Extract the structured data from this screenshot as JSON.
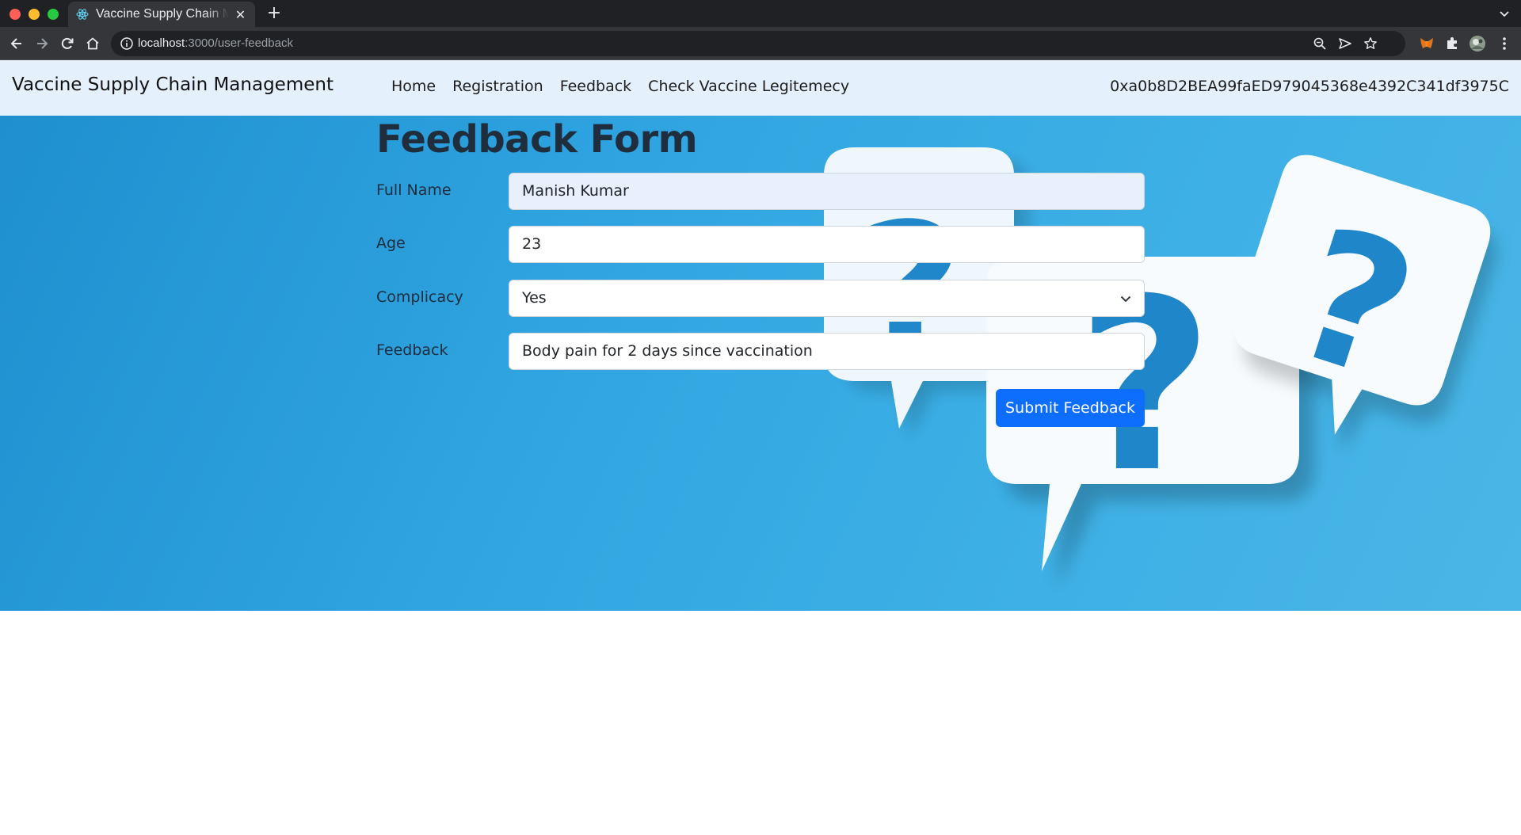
{
  "browser": {
    "tab_title": "Vaccine Supply Chain Management",
    "url_host": "localhost",
    "url_path": ":3000/user-feedback"
  },
  "navbar": {
    "brand": "Vaccine Supply Chain Management",
    "links": [
      "Home",
      "Registration",
      "Feedback",
      "Check Vaccine Legitemecy"
    ],
    "account": "0xa0b8D2BEA99faED979045368e4392C341df3975C"
  },
  "form": {
    "title": "Feedback Form",
    "full_name": {
      "label": "Full Name",
      "value": "Manish Kumar"
    },
    "age": {
      "label": "Age",
      "value": "23"
    },
    "complicacy": {
      "label": "Complicacy",
      "value": "Yes"
    },
    "feedback": {
      "label": "Feedback",
      "value": "Body pain for 2 days since vaccination"
    },
    "submit_label": "Submit Feedback"
  },
  "colors": {
    "navbar_bg": "#e4f0fb",
    "hero_blue": "#2ea4df",
    "primary_button": "#0d6efd",
    "autofill_bg": "#e8f0fe"
  },
  "icons": [
    "back-icon",
    "forward-icon",
    "reload-icon",
    "home-icon",
    "info-icon",
    "zoom-icon",
    "send-icon",
    "star-icon",
    "metamask-icon",
    "extensions-icon",
    "profile-avatar",
    "menu-icon",
    "react-favicon",
    "question-bubble-art"
  ]
}
